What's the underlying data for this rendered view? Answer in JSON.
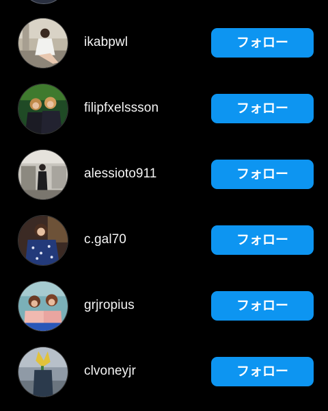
{
  "list": {
    "follow_label": "フォロー",
    "items": [
      {
        "username": "ikabpwl",
        "avatar": "avatar-photo-icon"
      },
      {
        "username": "filipfxelssson",
        "avatar": "avatar-photo-icon"
      },
      {
        "username": "alessioto911",
        "avatar": "avatar-photo-icon"
      },
      {
        "username": "c.gal70",
        "avatar": "avatar-photo-icon"
      },
      {
        "username": "grjropius",
        "avatar": "avatar-photo-icon"
      },
      {
        "username": "clvoneyjr",
        "avatar": "avatar-photo-icon"
      }
    ]
  },
  "colors": {
    "background": "#000000",
    "button": "#0d95f1",
    "text": "#ffffff"
  }
}
